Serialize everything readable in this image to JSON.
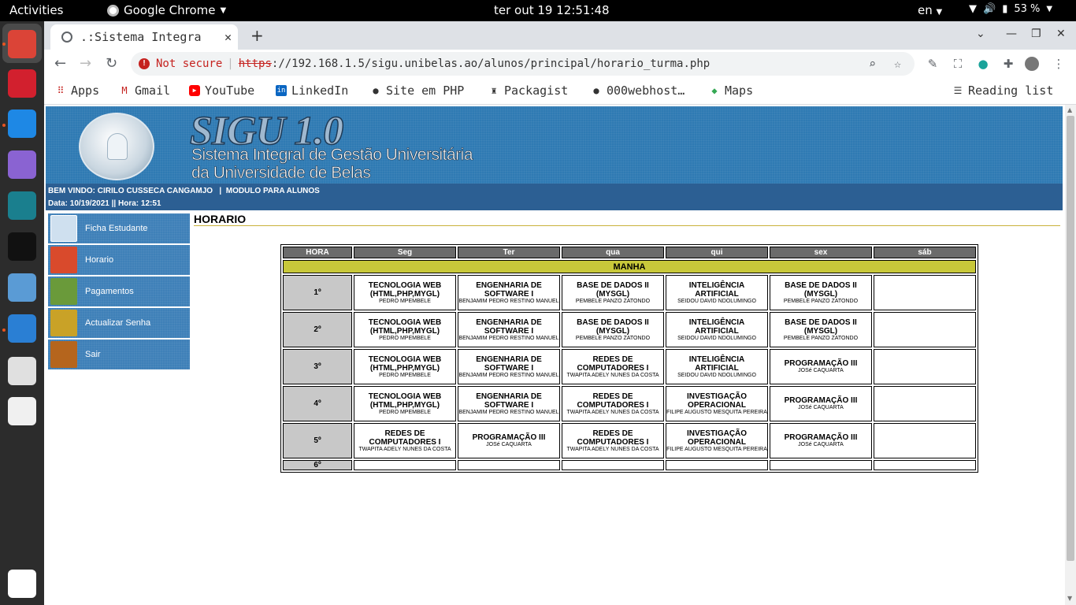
{
  "os": {
    "activities": "Activities",
    "app_name": "Google Chrome",
    "clock": "ter out 19 12:51:48",
    "lang": "en",
    "battery": "53 %"
  },
  "browser": {
    "tab_title": ".:Sistema Integra",
    "new_tab": "+",
    "omnibox": {
      "security": "Not secure",
      "scheme": "https",
      "url_rest": "://192.168.1.5/sigu.unibelas.ao/alunos/principal/horario_turma.php"
    },
    "bookmarks": [
      {
        "label": "Apps",
        "icon": "apps-grid-icon"
      },
      {
        "label": "Gmail",
        "icon": "gmail-icon"
      },
      {
        "label": "YouTube",
        "icon": "youtube-icon"
      },
      {
        "label": "LinkedIn",
        "icon": "linkedin-icon"
      },
      {
        "label": "Site em PHP",
        "icon": "globe-icon"
      },
      {
        "label": "Packagist",
        "icon": "packagist-icon"
      },
      {
        "label": "000webhost…",
        "icon": "globe-icon"
      },
      {
        "label": "Maps",
        "icon": "maps-icon"
      }
    ],
    "reading_list": "Reading list"
  },
  "page": {
    "banner": {
      "title": "SIGU 1.0",
      "subtitle1": "Sistema Integral de Gestão Universitária",
      "subtitle2": "da Universidade de Belas"
    },
    "info": {
      "welcome": "BEM VINDO: CIRILO CUSSECA CANGAMJO   |  MODULO PARA ALUNOS",
      "datetime": "Data: 10/19/2021 || Hora: 12:51"
    },
    "menu": [
      {
        "label": "Ficha Estudante",
        "icon": "student-icon",
        "color": "#2d4e7a"
      },
      {
        "label": "Horario",
        "icon": "calendar-icon",
        "color": "#d94a2c"
      },
      {
        "label": "Pagamentos",
        "icon": "money-icon",
        "color": "#6a9a3a"
      },
      {
        "label": "Actualizar Senha",
        "icon": "key-icon",
        "color": "#c9a227"
      },
      {
        "label": "Sair",
        "icon": "exit-door-icon",
        "color": "#b5651d"
      }
    ],
    "section_title": "HORARIO",
    "schedule": {
      "headers": [
        "HORA",
        "Seg",
        "Ter",
        "qua",
        "qui",
        "sex",
        "sáb"
      ],
      "period": "MANHA",
      "rows": [
        {
          "hora": "1º",
          "cells": [
            {
              "subject": "TECNOLOGIA WEB (HTML,PHP,MYGL)",
              "prof": "PEDRO MPEMBELE"
            },
            {
              "subject": "ENGENHARIA DE SOFTWARE I",
              "prof": "BENJAMIM PEDRO RESTINO MANUEL"
            },
            {
              "subject": "BASE DE DADOS II (MYSGL)",
              "prof": "PEMBELE PANZO ZATONDO"
            },
            {
              "subject": "INTELIGÊNCIA ARTIFICIAL",
              "prof": "SEIDOU DAVID NDOLUMINGO"
            },
            {
              "subject": "BASE DE DADOS II (MYSGL)",
              "prof": "PEMBELE PANZO ZATONDO"
            },
            {
              "subject": "",
              "prof": ""
            }
          ]
        },
        {
          "hora": "2º",
          "cells": [
            {
              "subject": "TECNOLOGIA WEB (HTML,PHP,MYGL)",
              "prof": "PEDRO MPEMBELE"
            },
            {
              "subject": "ENGENHARIA DE SOFTWARE I",
              "prof": "BENJAMIM PEDRO RESTINO MANUEL"
            },
            {
              "subject": "BASE DE DADOS II (MYSGL)",
              "prof": "PEMBELE PANZO ZATONDO"
            },
            {
              "subject": "INTELIGÊNCIA ARTIFICIAL",
              "prof": "SEIDOU DAVID NDOLUMINGO"
            },
            {
              "subject": "BASE DE DADOS II (MYSGL)",
              "prof": "PEMBELE PANZO ZATONDO"
            },
            {
              "subject": "",
              "prof": ""
            }
          ]
        },
        {
          "hora": "3º",
          "cells": [
            {
              "subject": "TECNOLOGIA WEB (HTML,PHP,MYGL)",
              "prof": "PEDRO MPEMBELE"
            },
            {
              "subject": "ENGENHARIA DE SOFTWARE I",
              "prof": "BENJAMIM PEDRO RESTINO MANUEL"
            },
            {
              "subject": "REDES DE COMPUTADORES I",
              "prof": "TWAPITA ADELY NUNES DA COSTA"
            },
            {
              "subject": "INTELIGÊNCIA ARTIFICIAL",
              "prof": "SEIDOU DAVID NDOLUMINGO"
            },
            {
              "subject": "PROGRAMAÇÃO III",
              "prof": "JOSé CAQUARTA"
            },
            {
              "subject": "",
              "prof": ""
            }
          ]
        },
        {
          "hora": "4º",
          "cells": [
            {
              "subject": "TECNOLOGIA WEB (HTML,PHP,MYGL)",
              "prof": "PEDRO MPEMBELE"
            },
            {
              "subject": "ENGENHARIA DE SOFTWARE I",
              "prof": "BENJAMIM PEDRO RESTINO MANUEL"
            },
            {
              "subject": "REDES DE COMPUTADORES I",
              "prof": "TWAPITA ADELY NUNES DA COSTA"
            },
            {
              "subject": "INVESTIGAÇÃO OPERACIONAL",
              "prof": "FILIPE AUGUSTO MESQUITA PEREIRA"
            },
            {
              "subject": "PROGRAMAÇÃO III",
              "prof": "JOSé CAQUARTA"
            },
            {
              "subject": "",
              "prof": ""
            }
          ]
        },
        {
          "hora": "5º",
          "cells": [
            {
              "subject": "REDES DE COMPUTADORES I",
              "prof": "TWAPITA ADELY NUNES DA COSTA"
            },
            {
              "subject": "PROGRAMAÇÃO III",
              "prof": "JOSé CAQUARTA"
            },
            {
              "subject": "REDES DE COMPUTADORES I",
              "prof": "TWAPITA ADELY NUNES DA COSTA"
            },
            {
              "subject": "INVESTIGAÇÃO OPERACIONAL",
              "prof": "FILIPE AUGUSTO MESQUITA PEREIRA"
            },
            {
              "subject": "PROGRAMAÇÃO III",
              "prof": "JOSé CAQUARTA"
            },
            {
              "subject": "",
              "prof": ""
            }
          ]
        },
        {
          "hora": "6º",
          "cells": [
            {
              "subject": "",
              "prof": ""
            },
            {
              "subject": "",
              "prof": ""
            },
            {
              "subject": "",
              "prof": ""
            },
            {
              "subject": "",
              "prof": ""
            },
            {
              "subject": "",
              "prof": ""
            },
            {
              "subject": "",
              "prof": ""
            }
          ]
        }
      ]
    }
  },
  "dock": [
    {
      "icon": "chrome-icon",
      "color": "#db4437"
    },
    {
      "icon": "opera-icon",
      "color": "#d2202e"
    },
    {
      "icon": "vscode-icon",
      "color": "#1e88e5"
    },
    {
      "icon": "github-icon",
      "color": "#8a63d2"
    },
    {
      "icon": "mysql-workbench-icon",
      "color": "#1a7f8e"
    },
    {
      "icon": "terminal-icon",
      "color": "#111111"
    },
    {
      "icon": "files-icon",
      "color": "#5a9bd5"
    },
    {
      "icon": "writer-icon",
      "color": "#2a7fd4"
    },
    {
      "icon": "software-store-icon",
      "color": "#e0e0e0"
    },
    {
      "icon": "usb-drive-icon",
      "color": "#f0f0f0"
    },
    {
      "icon": "show-apps-icon",
      "color": "#ffffff"
    }
  ]
}
